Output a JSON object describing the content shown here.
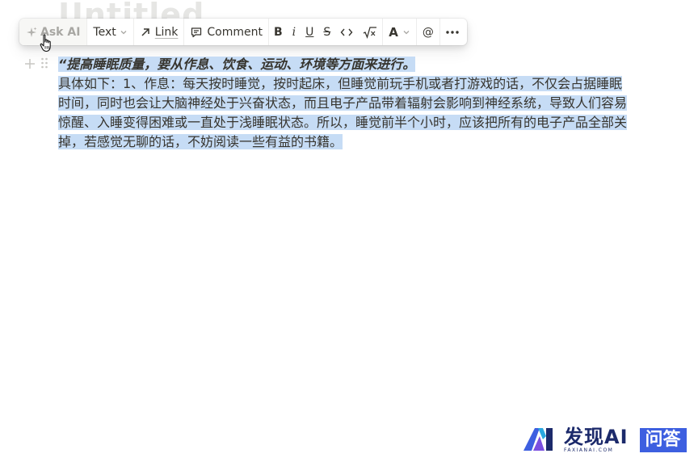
{
  "page": {
    "title_ghost": "Untitled"
  },
  "toolbar": {
    "ask_ai": "Ask AI",
    "text": "Text",
    "link": "Link",
    "comment": "Comment",
    "bold": "B",
    "italic": "i",
    "underline": "U",
    "strike": "S",
    "color": "A",
    "mention": "@"
  },
  "content": {
    "heading": "“提高睡眠质量，要从作息、饮食、运动、环境等方面来进行。",
    "body": "具体如下：1、作息：每天按时睡觉，按时起床，但睡觉前玩手机或者打游戏的话，不仅会占据睡眠时间，同时也会让大脑神经处于兴奋状态，而且电子产品带着辐射会影响到神经系统，导致人们容易惊醒、入睡变得困难或一直处于浅睡眠状态。所以，睡觉前半个小时，应该把所有的电子产品全部关掉，若感觉无聊的话，不妨阅读一些有益的书籍。"
  },
  "watermark": {
    "title": "发现AI",
    "subtitle": "FAXIANAI.COM",
    "badge": "问答",
    "colors": {
      "navy": "#1c2a6b",
      "blue": "#3d5fe0"
    }
  },
  "colors": {
    "selection": "#c6dcf5",
    "text": "#37352f",
    "muted": "#a8a7a3"
  }
}
